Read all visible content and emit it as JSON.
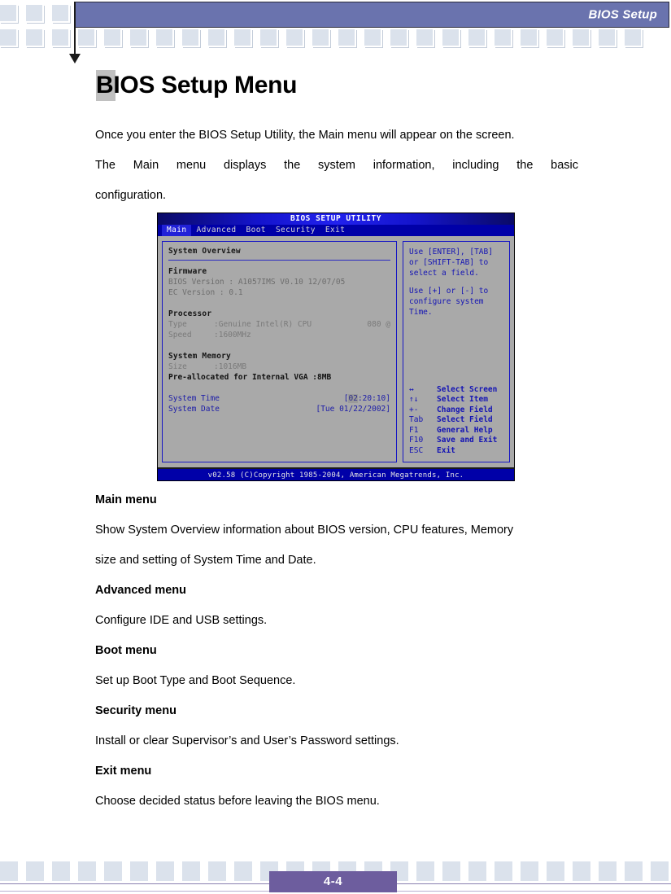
{
  "header": {
    "title": "BIOS Setup"
  },
  "page": {
    "title": "BIOS Setup Menu",
    "intro_1": "Once you enter the BIOS Setup Utility, the Main menu will appear on the screen.",
    "intro_2": "The Main menu displays the system information, including the basic",
    "intro_3": "configuration."
  },
  "bios": {
    "utility_title": "BIOS SETUP UTILITY",
    "tabs": [
      {
        "label": "Main",
        "active": true
      },
      {
        "label": "Advanced",
        "active": false
      },
      {
        "label": "Boot",
        "active": false
      },
      {
        "label": "Security",
        "active": false
      },
      {
        "label": "Exit",
        "active": false
      }
    ],
    "overview_title": "System Overview",
    "firmware": {
      "heading": "Firmware",
      "bios_version_label": "BIOS Version :",
      "bios_version_value": "A1057IMS V0.10 12/07/05",
      "ec_version_label": "EC   Version :",
      "ec_version_value": "0.1"
    },
    "processor": {
      "heading": "Processor",
      "type_label": "Type",
      "type_value": ":Genuine Intel(R) CPU",
      "type_extra": "080  @",
      "speed_label": "Speed",
      "speed_value": ":1600MHz"
    },
    "memory": {
      "heading": "System Memory",
      "size_label": "Size",
      "size_value": ":1016MB",
      "vga_label": "Pre-allocated for Internal VGA :8MB"
    },
    "time": {
      "label": "System Time",
      "bracket_open": "[",
      "hours": "02",
      "rest": ":20:10",
      "bracket_close": "]"
    },
    "date": {
      "label": "System Date",
      "value": "[Tue 01/22/2002]"
    },
    "help": {
      "line1": "Use [ENTER], [TAB]",
      "line2": "or [SHIFT-TAB] to",
      "line3": "select a field.",
      "line4": "Use [+] or [-] to",
      "line5": "configure system Time."
    },
    "legend": [
      {
        "key": "↔",
        "action": "Select Screen"
      },
      {
        "key": "↑↓",
        "action": "Select Item"
      },
      {
        "key": "+-",
        "action": "Change Field"
      },
      {
        "key": "Tab",
        "action": "Select Field"
      },
      {
        "key": "F1",
        "action": "General Help"
      },
      {
        "key": "F10",
        "action": "Save and Exit"
      },
      {
        "key": "ESC",
        "action": "Exit"
      }
    ],
    "footer": "v02.58 (C)Copyright 1985-2004, American Megatrends, Inc."
  },
  "menus": [
    {
      "heading": "Main menu",
      "desc_line1": "Show System Overview information about BIOS version, CPU features, Memory",
      "desc_line2": "size and setting of System Time and Date."
    },
    {
      "heading": "Advanced menu",
      "desc_line1": "Configure IDE and USB settings.",
      "desc_line2": ""
    },
    {
      "heading": "Boot menu",
      "desc_line1": "Set up Boot Type and Boot Sequence.",
      "desc_line2": ""
    },
    {
      "heading": "Security menu",
      "desc_line1": "Install or clear Supervisor’s and User’s Password settings.",
      "desc_line2": ""
    },
    {
      "heading": "Exit menu",
      "desc_line1": "Choose decided status before leaving the BIOS menu.",
      "desc_line2": ""
    }
  ],
  "footer": {
    "page_number": "4-4"
  },
  "colors": {
    "header_bar": "#6a73ae",
    "deco_square": "#dbe2ec",
    "page_num_box": "#6d5d9e",
    "bios_blue": "#0000a8",
    "bios_gray": "#a9a9a9"
  }
}
